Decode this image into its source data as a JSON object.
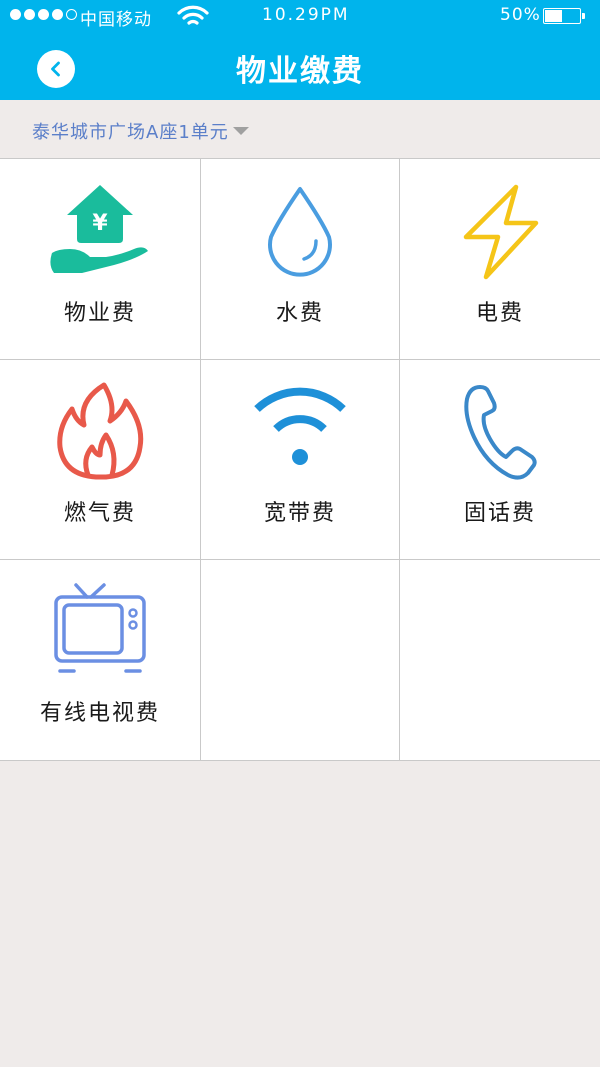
{
  "status_bar": {
    "carrier": "中国移动",
    "time": "10.29PM",
    "battery": "50%",
    "battery_level": 0.5,
    "signal_bars": 4
  },
  "header": {
    "title": "物业缴费"
  },
  "location": {
    "value": "泰华城市广场A座1单元"
  },
  "services": [
    {
      "label": "物业费",
      "icon": "property-fee-icon",
      "color": "#1abc9c"
    },
    {
      "label": "水费",
      "icon": "water-drop-icon",
      "color": "#4a9de0"
    },
    {
      "label": "电费",
      "icon": "lightning-icon",
      "color": "#f5c518"
    },
    {
      "label": "燃气费",
      "icon": "flame-icon",
      "color": "#e8594a"
    },
    {
      "label": "宽带费",
      "icon": "wifi-icon",
      "color": "#1e90d8"
    },
    {
      "label": "固话费",
      "icon": "phone-icon",
      "color": "#3a88c9"
    },
    {
      "label": "有线电视费",
      "icon": "tv-icon",
      "color": "#6b8fe3"
    }
  ],
  "colors": {
    "header_bg": "#00b4ec",
    "location_text": "#5b7fc9",
    "page_bg": "#efebea"
  }
}
